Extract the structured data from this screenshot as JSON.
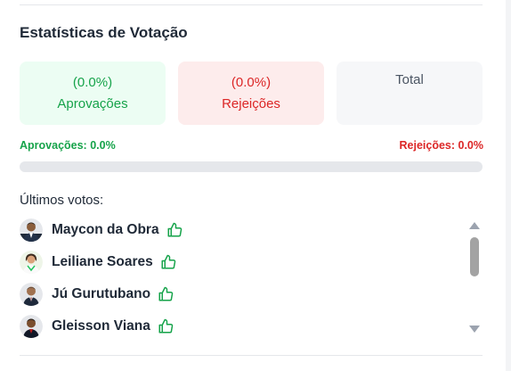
{
  "stats": {
    "title": "Estatísticas de Votação",
    "approvals_card": {
      "percent": "(0.0%)",
      "label": "Aprovações"
    },
    "rejections_card": {
      "percent": "(0.0%)",
      "label": "Rejeições"
    },
    "total_card": {
      "label": "Total"
    },
    "approvals_legend": "Aprovações: 0.0%",
    "rejections_legend": "Rejeições: 0.0%",
    "approval_fraction": 0.0
  },
  "recent_votes": {
    "heading": "Últimos votos:",
    "items": [
      {
        "name": "Maycon da Obra",
        "vote": "approve"
      },
      {
        "name": "Leiliane Soares",
        "vote": "approve"
      },
      {
        "name": "Jú Gurutubano",
        "vote": "approve"
      },
      {
        "name": "Gleisson Viana",
        "vote": "approve"
      }
    ]
  },
  "colors": {
    "approve": "#16a34a",
    "reject": "#dc2626",
    "approve_bg": "#ecfdf3",
    "reject_bg": "#fdecec",
    "neutral_bg": "#f6f7f9"
  },
  "icons": {
    "vote_approve": "thumbs-up-icon"
  }
}
